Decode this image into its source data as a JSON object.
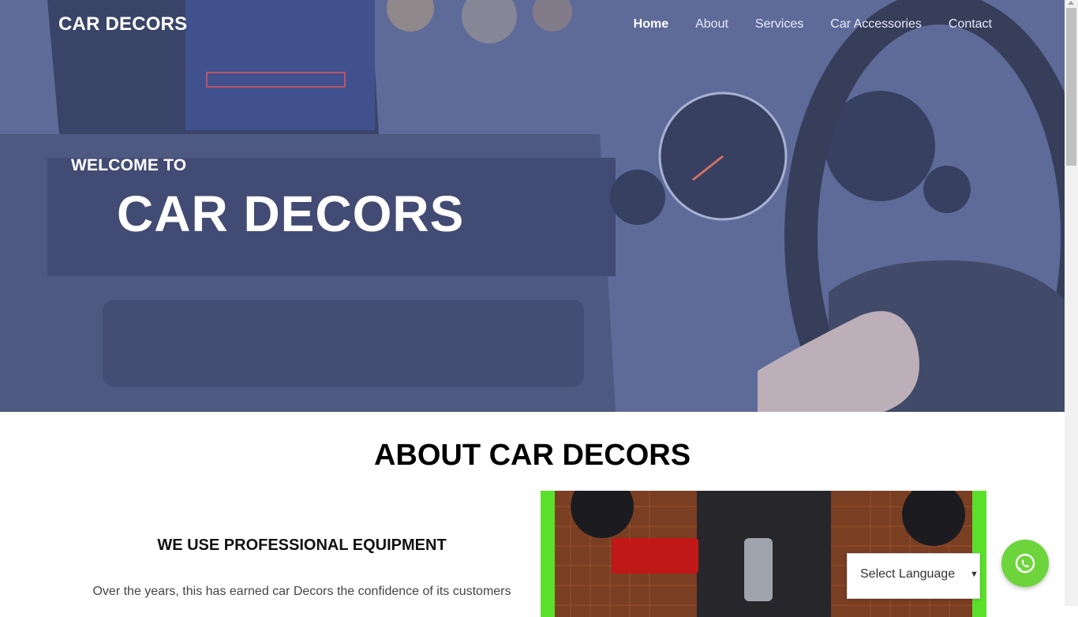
{
  "brand": "CAR DECORS",
  "nav": {
    "items": [
      "Home",
      "About",
      "Services",
      "Car Accessories",
      "Contact"
    ],
    "active": "Home"
  },
  "hero": {
    "welcome": "WELCOME TO",
    "title": "CAR DECORS"
  },
  "about": {
    "heading": "ABOUT CAR DECORS",
    "subheading": "WE USE PROFESSIONAL EQUIPMENT",
    "text": "Over the years, this has earned car Decors the confidence of its customers"
  },
  "language_select": {
    "label": "Select Language"
  },
  "colors": {
    "accent_green": "#5ae02a",
    "whatsapp_green": "#6dd53b",
    "hero_overlay": "#6e7db4"
  }
}
